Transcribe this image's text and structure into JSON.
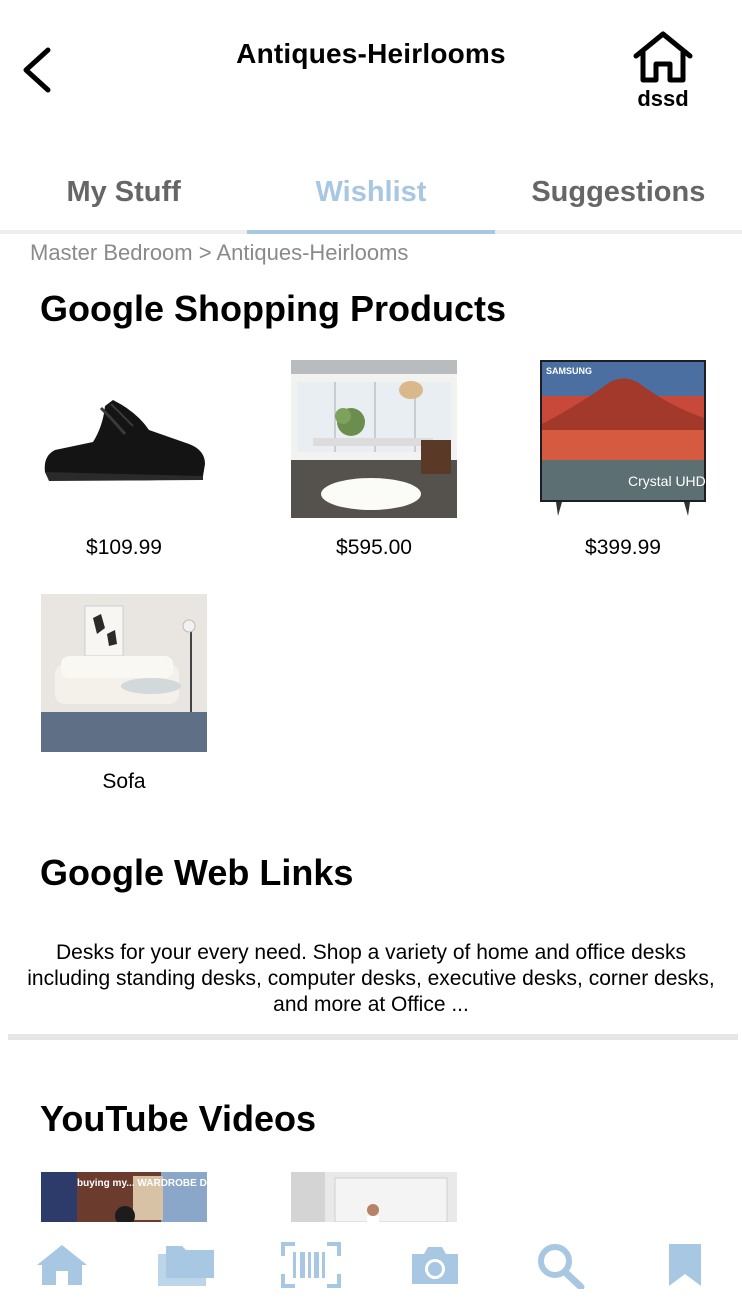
{
  "header": {
    "title": "Antiques-Heirlooms",
    "home_label": "dssd"
  },
  "tabs": [
    {
      "label": "My Stuff",
      "active": false
    },
    {
      "label": "Wishlist",
      "active": true
    },
    {
      "label": "Suggestions",
      "active": false
    }
  ],
  "breadcrumb": "Master Bedroom > Antiques-Heirlooms",
  "shopping": {
    "title": "Google Shopping Products",
    "products": [
      {
        "label": "$109.99",
        "image": "black-sneaker"
      },
      {
        "label": "$595.00",
        "image": "dining-room"
      },
      {
        "label": "$399.99",
        "image": "samsung-tv"
      },
      {
        "label": "Sofa",
        "image": "living-room-sofa"
      }
    ],
    "tv_brand": "SAMSUNG",
    "tv_caption": "Crystal UHD"
  },
  "web_links": {
    "title": "Google Web Links",
    "snippet": "Desks for your every need. Shop a variety of home and office desks including standing desks, computer desks, executive desks, corner desks, and more at Office ..."
  },
  "youtube": {
    "title": "YouTube Videos",
    "thumb_text": "buying my... WARDROBE DREAM"
  },
  "bottom_nav": [
    {
      "icon": "home-icon"
    },
    {
      "icon": "folders-icon"
    },
    {
      "icon": "barcode-icon"
    },
    {
      "icon": "camera-icon"
    },
    {
      "icon": "search-icon"
    },
    {
      "icon": "bookmark-icon"
    }
  ],
  "colors": {
    "accent": "#a7c7e2",
    "nav_icon": "#a7c7e2",
    "tab_inactive": "#666666",
    "breadcrumb": "#8a8a8a"
  }
}
